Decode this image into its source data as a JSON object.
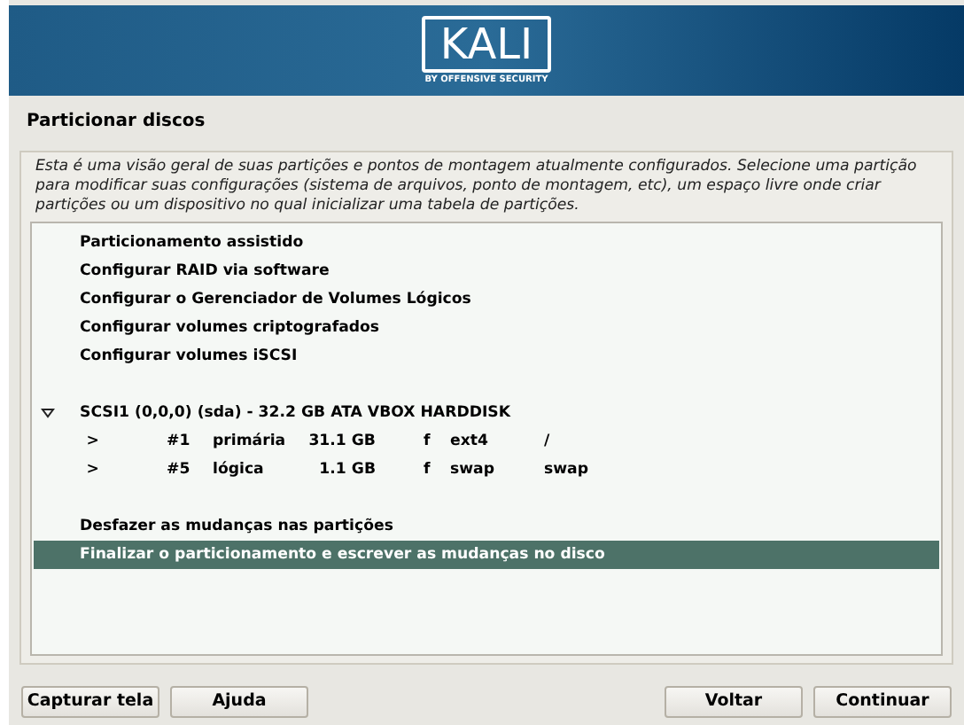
{
  "banner": {
    "logo": "KALI",
    "tagline": "BY OFFENSIVE SECURITY"
  },
  "title": "Particionar discos",
  "description": "Esta é uma visão geral de suas partições e pontos de montagem atualmente configurados. Selecione uma partição para modificar suas configurações (sistema de arquivos, ponto de montagem, etc), um espaço livre onde criar partições ou um dispositivo no qual inicializar uma tabela de partições.",
  "top_actions": [
    {
      "label": "Particionamento assistido",
      "selected": false
    },
    {
      "label": "Configurar RAID via software",
      "selected": false
    },
    {
      "label": "Configurar o Gerenciador de Volumes Lógicos",
      "selected": false
    },
    {
      "label": "Configurar volumes criptografados",
      "selected": false
    },
    {
      "label": "Configurar volumes iSCSI",
      "selected": false
    }
  ],
  "disk": {
    "label": "SCSI1 (0,0,0) (sda) - 32.2 GB ATA VBOX HARDDISK",
    "expanded": true,
    "selected": false,
    "partitions": [
      {
        "marker": ">",
        "number": "#1",
        "type": "primária",
        "size": "31.1 GB",
        "flag": "f",
        "filesystem": "ext4",
        "mount": "/",
        "selected": false
      },
      {
        "marker": ">",
        "number": "#5",
        "type": "lógica",
        "size": "1.1 GB",
        "flag": "f",
        "filesystem": "swap",
        "mount": "swap",
        "selected": false
      }
    ]
  },
  "bottom_actions": [
    {
      "label": "Desfazer as mudanças nas partições",
      "selected": false
    },
    {
      "label": "Finalizar o particionamento e escrever as mudanças no disco",
      "selected": true
    }
  ],
  "buttons_left": [
    "Capturar tela",
    "Ajuda"
  ],
  "buttons_right": [
    "Voltar",
    "Continuar"
  ]
}
